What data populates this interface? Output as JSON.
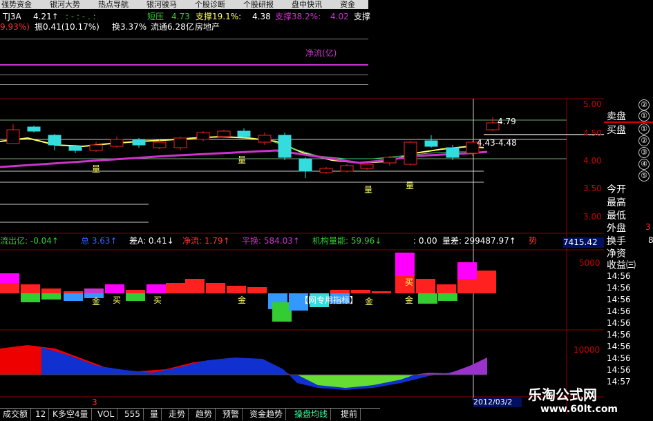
{
  "top_tabs": [
    "强势资金",
    "银河大势",
    "热点导航",
    "银河骏马",
    "个股诊断",
    "个股研报",
    "盘中快讯",
    "资金"
  ],
  "indicator_line1": {
    "name": "TJ3A",
    "value": "4.21↑",
    "dashes": ": - : - . :",
    "resist_label": "短压",
    "resist_value": "4.73",
    "support_label": "支撑19.1%:",
    "support_value": "4.38",
    "support2_label": "支撑38.2%:",
    "support2_value": "4.02",
    "support3_label": "支撑"
  },
  "indicator_line2": {
    "pct": "9.93%)",
    "amplitude": "振0.41(10.17%)",
    "turnover": "换3.37%",
    "float": "流通6.28亿",
    "sector": "房地产"
  },
  "net_flow_label": "净流(亿)",
  "main_chart": {
    "price_marker_high": "4.79",
    "price_marker_mid": "4.43-4.48",
    "labels": [
      "量",
      "量",
      "量",
      "量"
    ]
  },
  "scale_right": [
    "5.00",
    "4.50",
    "4.00",
    "3.50",
    "3.00"
  ],
  "status_line": {
    "outflow": "流出亿: -0.04↑",
    "label_blue": "总 3.63↑",
    "diff_a": "差A: 0.41↓",
    "net_flow": "净流: 1.79↑",
    "avg_swap": "平换: 584.03↑",
    "inst_power": "机构量能: 59.96↓",
    "zero": ": 0.00",
    "vol_diff": "量差: 299487.97↑",
    "tail": "势"
  },
  "vol_total": "7415.42",
  "mid_panel_labels": {
    "scale_5000": "5000",
    "signals": [
      "金",
      "买",
      "买",
      "金",
      "金",
      "买",
      "金"
    ],
    "banner": "【网专用指标】"
  },
  "bottom_panel_scale": "10000",
  "side_panel": {
    "ranks_top": [
      "②",
      "①"
    ],
    "sell_label": "卖盘",
    "buy_label": "买盘",
    "ranks_bottom": [
      "①",
      "②",
      "③",
      "④",
      "⑤"
    ],
    "stats": [
      "今开",
      "最高",
      "最低",
      "外盘",
      "换手",
      "净资",
      "收益㈢"
    ],
    "stat_values": [
      "",
      "",
      "",
      "3",
      "",
      "8",
      ""
    ]
  },
  "time_list": [
    "14:56",
    "14:56",
    "14:56",
    "14:56",
    "14:56",
    "14:56",
    "14:56",
    "14:56",
    "14:56",
    "14:57"
  ],
  "bottom_tabs": [
    "成交额",
    "12",
    "K多空4量",
    "VOL",
    "555",
    "量",
    "走势",
    "趋势",
    "预警",
    "资金趋势",
    "操盘均线",
    "提前"
  ],
  "bottom_left_mark": "3",
  "date_box": "2012/03/2",
  "watermark": {
    "main": "乐淘公式网",
    "url": "www.60lt.com"
  },
  "colors": {
    "up": "#ff0000",
    "down": "#00cccc",
    "ma_yellow": "#ffff66",
    "ma_magenta": "#cc33cc",
    "green": "#33cc33",
    "blue": "#3399ff"
  }
}
